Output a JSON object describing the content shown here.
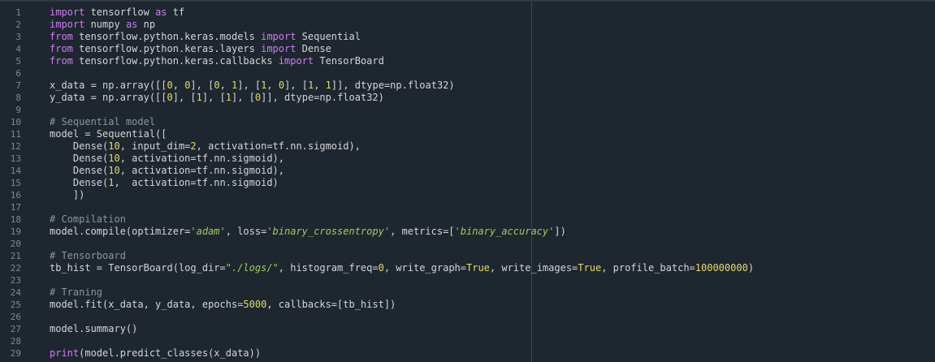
{
  "editor": {
    "lines": [
      {
        "num": "1",
        "tokens": [
          {
            "t": "import",
            "c": "kw"
          },
          {
            "t": " tensorflow ",
            "c": "plain"
          },
          {
            "t": "as",
            "c": "kw"
          },
          {
            "t": " tf",
            "c": "plain"
          }
        ]
      },
      {
        "num": "2",
        "tokens": [
          {
            "t": "import",
            "c": "kw"
          },
          {
            "t": " numpy ",
            "c": "plain"
          },
          {
            "t": "as",
            "c": "kw"
          },
          {
            "t": " np",
            "c": "plain"
          }
        ]
      },
      {
        "num": "3",
        "tokens": [
          {
            "t": "from",
            "c": "kw"
          },
          {
            "t": " tensorflow.python.keras.models ",
            "c": "plain"
          },
          {
            "t": "import",
            "c": "kw"
          },
          {
            "t": " Sequential",
            "c": "plain"
          }
        ]
      },
      {
        "num": "4",
        "tokens": [
          {
            "t": "from",
            "c": "kw"
          },
          {
            "t": " tensorflow.python.keras.layers ",
            "c": "plain"
          },
          {
            "t": "import",
            "c": "kw"
          },
          {
            "t": " Dense",
            "c": "plain"
          }
        ]
      },
      {
        "num": "5",
        "tokens": [
          {
            "t": "from",
            "c": "kw"
          },
          {
            "t": " tensorflow.python.keras.callbacks ",
            "c": "plain"
          },
          {
            "t": "import",
            "c": "kw"
          },
          {
            "t": " TensorBoard",
            "c": "plain"
          }
        ]
      },
      {
        "num": "6",
        "tokens": []
      },
      {
        "num": "7",
        "tokens": [
          {
            "t": "x_data = np.array([[",
            "c": "plain"
          },
          {
            "t": "0",
            "c": "num"
          },
          {
            "t": ", ",
            "c": "plain"
          },
          {
            "t": "0",
            "c": "num"
          },
          {
            "t": "], [",
            "c": "plain"
          },
          {
            "t": "0",
            "c": "num"
          },
          {
            "t": ", ",
            "c": "plain"
          },
          {
            "t": "1",
            "c": "num"
          },
          {
            "t": "], [",
            "c": "plain"
          },
          {
            "t": "1",
            "c": "num"
          },
          {
            "t": ", ",
            "c": "plain"
          },
          {
            "t": "0",
            "c": "num"
          },
          {
            "t": "], [",
            "c": "plain"
          },
          {
            "t": "1",
            "c": "num"
          },
          {
            "t": ", ",
            "c": "plain"
          },
          {
            "t": "1",
            "c": "num"
          },
          {
            "t": "]], dtype=np.float32)",
            "c": "plain"
          }
        ]
      },
      {
        "num": "8",
        "tokens": [
          {
            "t": "y_data = np.array([[",
            "c": "plain"
          },
          {
            "t": "0",
            "c": "num"
          },
          {
            "t": "], [",
            "c": "plain"
          },
          {
            "t": "1",
            "c": "num"
          },
          {
            "t": "], [",
            "c": "plain"
          },
          {
            "t": "1",
            "c": "num"
          },
          {
            "t": "], [",
            "c": "plain"
          },
          {
            "t": "0",
            "c": "num"
          },
          {
            "t": "]], dtype=np.float32)",
            "c": "plain"
          }
        ]
      },
      {
        "num": "9",
        "tokens": []
      },
      {
        "num": "10",
        "tokens": [
          {
            "t": "# Sequential model",
            "c": "cm"
          }
        ]
      },
      {
        "num": "11",
        "tokens": [
          {
            "t": "model = Sequential([",
            "c": "plain"
          }
        ]
      },
      {
        "num": "12",
        "tokens": [
          {
            "t": "    Dense(",
            "c": "plain"
          },
          {
            "t": "10",
            "c": "num"
          },
          {
            "t": ", input_dim=",
            "c": "plain"
          },
          {
            "t": "2",
            "c": "num"
          },
          {
            "t": ", activation=tf.nn.sigmoid),",
            "c": "plain"
          }
        ]
      },
      {
        "num": "13",
        "tokens": [
          {
            "t": "    Dense(",
            "c": "plain"
          },
          {
            "t": "10",
            "c": "num"
          },
          {
            "t": ", activation=tf.nn.sigmoid),",
            "c": "plain"
          }
        ]
      },
      {
        "num": "14",
        "tokens": [
          {
            "t": "    Dense(",
            "c": "plain"
          },
          {
            "t": "10",
            "c": "num"
          },
          {
            "t": ", activation=tf.nn.sigmoid),",
            "c": "plain"
          }
        ]
      },
      {
        "num": "15",
        "tokens": [
          {
            "t": "    Dense(",
            "c": "plain"
          },
          {
            "t": "1",
            "c": "num"
          },
          {
            "t": ",  activation=tf.nn.sigmoid)",
            "c": "plain"
          }
        ]
      },
      {
        "num": "16",
        "tokens": [
          {
            "t": "    ])",
            "c": "plain"
          }
        ]
      },
      {
        "num": "17",
        "tokens": []
      },
      {
        "num": "18",
        "tokens": [
          {
            "t": "# Compilation",
            "c": "cm"
          }
        ]
      },
      {
        "num": "19",
        "tokens": [
          {
            "t": "model.compile(optimizer=",
            "c": "plain"
          },
          {
            "t": "'adam'",
            "c": "str"
          },
          {
            "t": ", loss=",
            "c": "plain"
          },
          {
            "t": "'binary_crossentropy'",
            "c": "str"
          },
          {
            "t": ", metrics=[",
            "c": "plain"
          },
          {
            "t": "'binary_accuracy'",
            "c": "str"
          },
          {
            "t": "])",
            "c": "plain"
          }
        ]
      },
      {
        "num": "20",
        "tokens": []
      },
      {
        "num": "21",
        "tokens": [
          {
            "t": "# Tensorboard",
            "c": "cm"
          }
        ]
      },
      {
        "num": "22",
        "tokens": [
          {
            "t": "tb_hist = TensorBoard(log_dir=",
            "c": "plain"
          },
          {
            "t": "\"./logs/\"",
            "c": "str"
          },
          {
            "t": ", histogram_freq=",
            "c": "plain"
          },
          {
            "t": "0",
            "c": "num"
          },
          {
            "t": ", write_graph=",
            "c": "plain"
          },
          {
            "t": "True",
            "c": "const"
          },
          {
            "t": ", write_images=",
            "c": "plain"
          },
          {
            "t": "True",
            "c": "const"
          },
          {
            "t": ", profile_batch=",
            "c": "plain"
          },
          {
            "t": "100000000",
            "c": "num"
          },
          {
            "t": ")",
            "c": "plain"
          }
        ]
      },
      {
        "num": "23",
        "tokens": []
      },
      {
        "num": "24",
        "tokens": [
          {
            "t": "# Traning",
            "c": "cm"
          }
        ]
      },
      {
        "num": "25",
        "tokens": [
          {
            "t": "model.fit(x_data, y_data, epochs=",
            "c": "plain"
          },
          {
            "t": "5000",
            "c": "num"
          },
          {
            "t": ", callbacks=[tb_hist])",
            "c": "plain"
          }
        ]
      },
      {
        "num": "26",
        "tokens": []
      },
      {
        "num": "27",
        "tokens": [
          {
            "t": "model.summary()",
            "c": "plain"
          }
        ]
      },
      {
        "num": "28",
        "tokens": []
      },
      {
        "num": "29",
        "tokens": [
          {
            "t": "print",
            "c": "fn"
          },
          {
            "t": "(model.predict_classes(x_data))",
            "c": "plain"
          }
        ]
      }
    ]
  }
}
